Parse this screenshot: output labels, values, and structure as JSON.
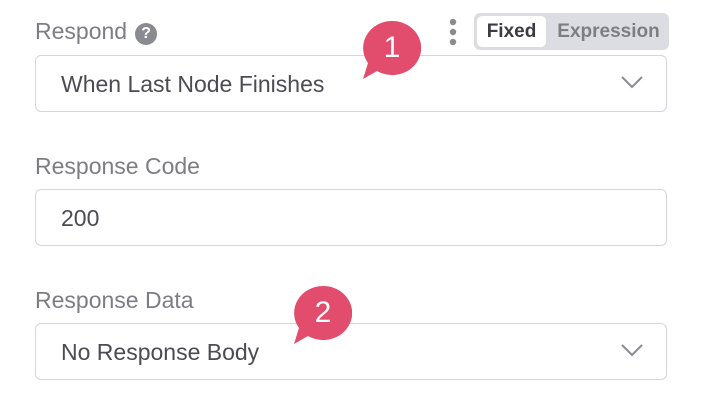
{
  "respond": {
    "label": "Respond",
    "help_icon_glyph": "?",
    "help_icon": "question-circle-icon",
    "options_icon": "kebab-icon",
    "value": "When Last Node Finishes",
    "dropdown_icon": "chevron-down-icon"
  },
  "mode_toggle": {
    "fixed_label": "Fixed",
    "expression_label": "Expression",
    "active": "Fixed"
  },
  "response_code": {
    "label": "Response Code",
    "value": "200"
  },
  "response_data": {
    "label": "Response Data",
    "value": "No Response Body",
    "dropdown_icon": "chevron-down-icon"
  },
  "annotations": [
    {
      "number": "1",
      "color": "#e34d6d"
    },
    {
      "number": "2",
      "color": "#e34d6d"
    }
  ]
}
